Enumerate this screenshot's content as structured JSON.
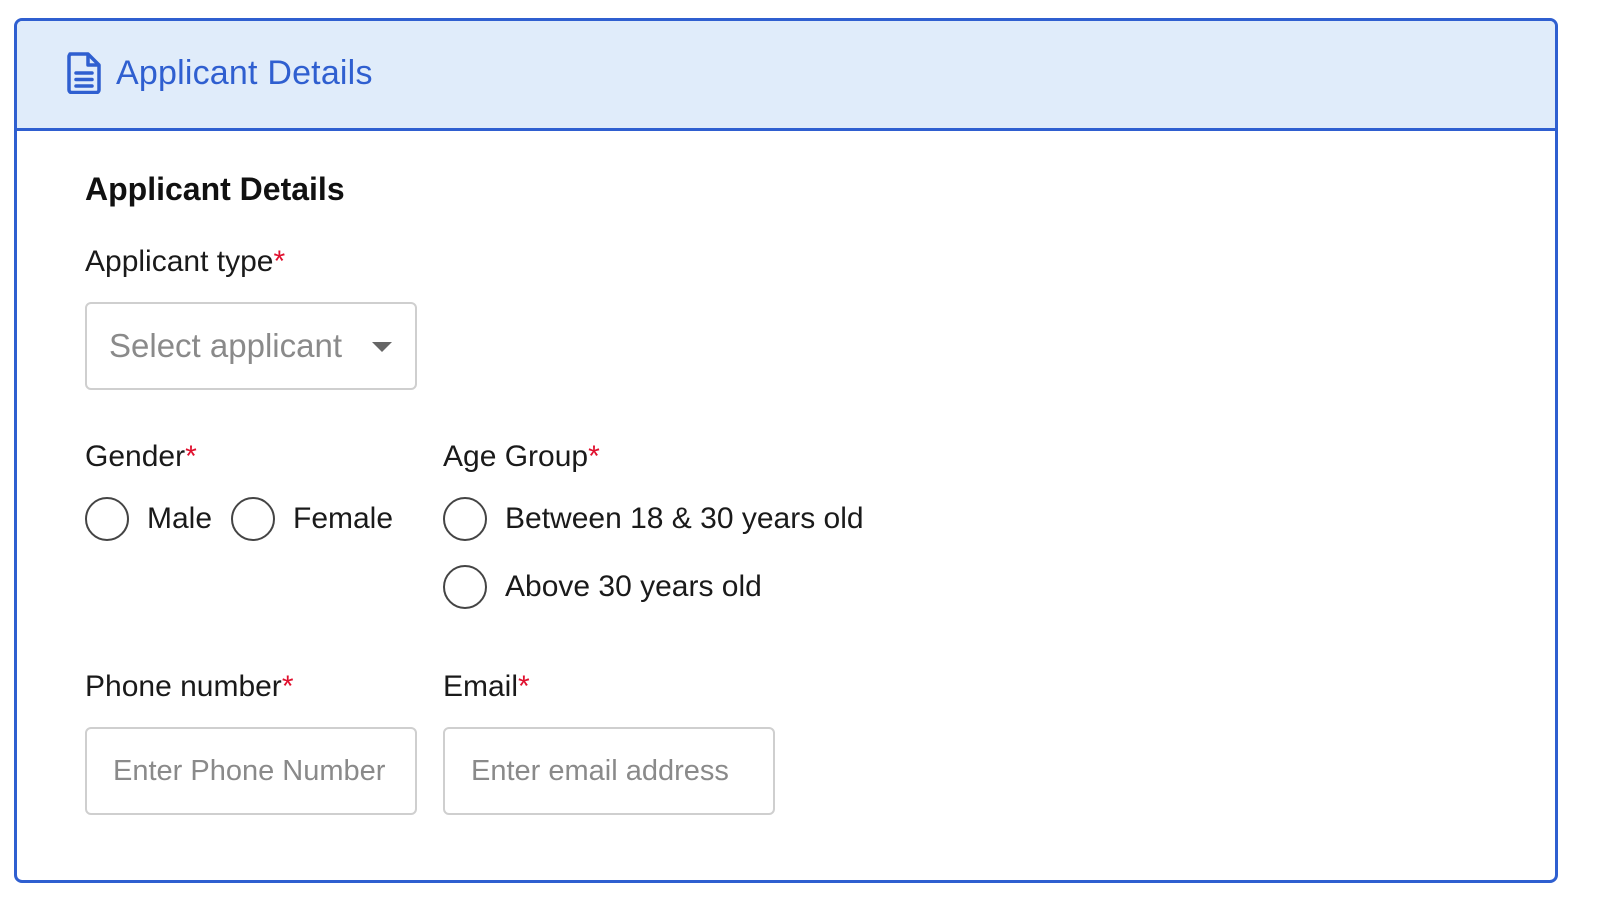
{
  "header": {
    "icon": "document-icon",
    "title": "Applicant Details"
  },
  "section": {
    "title": "Applicant Details"
  },
  "applicant_type": {
    "label": "Applicant type",
    "required_mark": "*",
    "placeholder": "Select applicant"
  },
  "gender": {
    "label": "Gender",
    "required_mark": "*",
    "options": [
      "Male",
      "Female"
    ],
    "selected": null
  },
  "age_group": {
    "label": "Age Group",
    "required_mark": "*",
    "options": [
      "Between 18 & 30 years old",
      "Above 30 years old"
    ],
    "selected": null
  },
  "phone": {
    "label": "Phone number",
    "required_mark": "*",
    "placeholder": "Enter Phone Number",
    "value": ""
  },
  "email": {
    "label": "Email",
    "required_mark": "*",
    "placeholder": "Enter email address",
    "value": ""
  },
  "colors": {
    "accent": "#2f5fd0",
    "header_bg": "#e0ecfa",
    "required": "#e0102e",
    "placeholder": "#8a8a8a"
  }
}
